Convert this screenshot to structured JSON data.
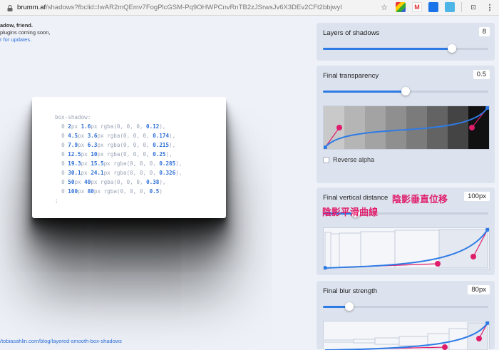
{
  "browser": {
    "host": "brumm.af",
    "path": "/shadows?fbclid=IwAR2mQEmv7FogPlcGSM-Pq9OHWPCnvRnTB2zJSrwsJv6X3DEv2CFt2bbjwyI"
  },
  "intro": {
    "line1": "adow, friend.",
    "line2": "plugins coming soon,",
    "line3": "r for updates."
  },
  "code": {
    "open": "box-shadow:",
    "close": ";",
    "lines": [
      {
        "a": "2",
        "b": "1.6",
        "c": "0.12"
      },
      {
        "a": "4.5",
        "b": "3.6",
        "c": "0.174"
      },
      {
        "a": "7.9",
        "b": "6.3",
        "c": "0.215"
      },
      {
        "a": "12.5",
        "b": "10",
        "c": "0.25"
      },
      {
        "a": "19.3",
        "b": "15.5",
        "c": "0.285"
      },
      {
        "a": "30.1",
        "b": "24.1",
        "c": "0.326"
      },
      {
        "a": "50",
        "b": "40",
        "c": "0.38"
      },
      {
        "a": "100",
        "b": "80",
        "c": "0.5"
      }
    ]
  },
  "footer_link": "/tobiasahlin.com/blog/layered-smooth-box-shadows",
  "controls": {
    "layers": {
      "label": "Layers of shadows",
      "value": "8",
      "fraction": 0.78
    },
    "transparency": {
      "label": "Final transparency",
      "value": "0.5",
      "fraction": 0.5,
      "reverse_label": "Reverse alpha"
    },
    "distance": {
      "label": "Final vertical distance",
      "value": "100px",
      "fraction": 0.2
    },
    "blur": {
      "label": "Final blur strength",
      "value": "80px",
      "fraction": 0.16
    }
  },
  "annotations": {
    "distance": "陰影垂直位移",
    "curve": "陰影平滑曲線"
  },
  "colors": {
    "accent": "#2f7be5",
    "handle": "#e01d6b",
    "annotation": "#e01d6b"
  }
}
